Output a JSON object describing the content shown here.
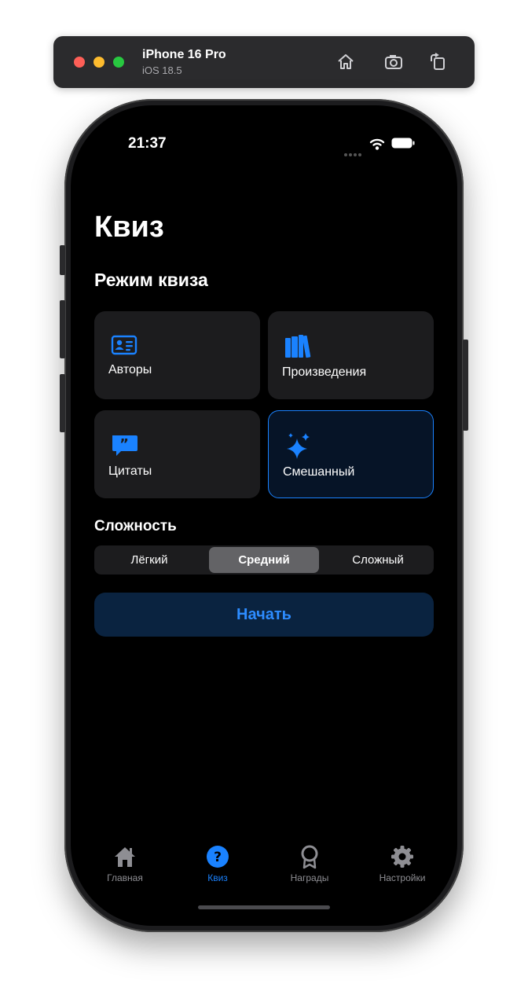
{
  "simulator": {
    "device_name": "iPhone 16 Pro",
    "os_version": "iOS 18.5",
    "icons": [
      "home-icon",
      "screenshot-icon",
      "rotate-icon"
    ]
  },
  "status_bar": {
    "time": "21:37",
    "icons": [
      "cellular-icon",
      "wifi-icon",
      "battery-icon"
    ]
  },
  "page": {
    "title": "Квиз",
    "mode_section_title": "Режим квиза",
    "modes": [
      {
        "label": "Авторы",
        "icon": "person-card-icon",
        "selected": false
      },
      {
        "label": "Произведения",
        "icon": "books-icon",
        "selected": false
      },
      {
        "label": "Цитаты",
        "icon": "quote-bubble-icon",
        "selected": false
      },
      {
        "label": "Смешанный",
        "icon": "sparkles-icon",
        "selected": true
      }
    ],
    "difficulty_title": "Сложность",
    "difficulty_options": [
      "Лёгкий",
      "Средний",
      "Сложный"
    ],
    "difficulty_selected": "Средний",
    "start_label": "Начать"
  },
  "tab_bar": {
    "items": [
      {
        "label": "Главная",
        "icon": "house-icon",
        "active": false
      },
      {
        "label": "Квиз",
        "icon": "question-circle-icon",
        "active": true
      },
      {
        "label": "Награды",
        "icon": "award-ribbon-icon",
        "active": false
      },
      {
        "label": "Настройки",
        "icon": "gear-icon",
        "active": false
      }
    ]
  },
  "colors": {
    "accent": "#1a82ff",
    "background": "#000000",
    "card": "#1c1c1e",
    "selected_card": "#061427",
    "start_button": "#0a2340"
  }
}
